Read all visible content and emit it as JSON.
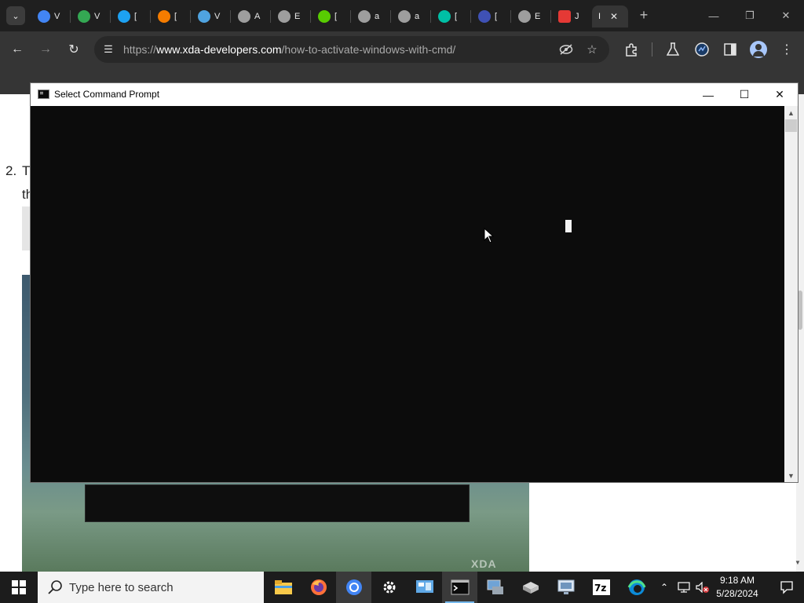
{
  "browser": {
    "tabs": [
      {
        "title": "V",
        "color": "#4285f4"
      },
      {
        "title": "V",
        "color": "#34a853"
      },
      {
        "title": "[",
        "color": "#1da1f2"
      },
      {
        "title": "[",
        "color": "#f57c00"
      },
      {
        "title": "V",
        "color": "#4fa3e0"
      },
      {
        "title": "A",
        "color": "#9e9e9e"
      },
      {
        "title": "E",
        "color": "#9e9e9e"
      },
      {
        "title": "[",
        "color": "#58cc02"
      },
      {
        "title": "a",
        "color": "#9e9e9e"
      },
      {
        "title": "a",
        "color": "#9e9e9e"
      },
      {
        "title": "[",
        "color": "#00bfa5"
      },
      {
        "title": "[",
        "color": "#3f51b5"
      },
      {
        "title": "E",
        "color": "#9e9e9e"
      },
      {
        "title": "J",
        "color": "#e53935"
      },
      {
        "title": "I",
        "color": "#ffffff"
      }
    ],
    "url": {
      "prefix": "https://",
      "host": "www.xda-developers.com",
      "path": "/how-to-activate-windows-with-cmd/"
    }
  },
  "page": {
    "step_number": "2.",
    "step_text_start": "T",
    "step_text_line2": "th",
    "watermark": "XDA"
  },
  "cmd": {
    "title": "Select Command Prompt"
  },
  "taskbar": {
    "search_placeholder": "Type here to search",
    "time": "9:18 AM",
    "date": "5/28/2024",
    "apps": [
      "file-explorer",
      "firefox",
      "chrome",
      "settings",
      "control-panel",
      "command-prompt",
      "computer-management",
      "disk-tool",
      "remote-desktop",
      "7zip",
      "edge"
    ],
    "accent": "#76b9ed"
  }
}
